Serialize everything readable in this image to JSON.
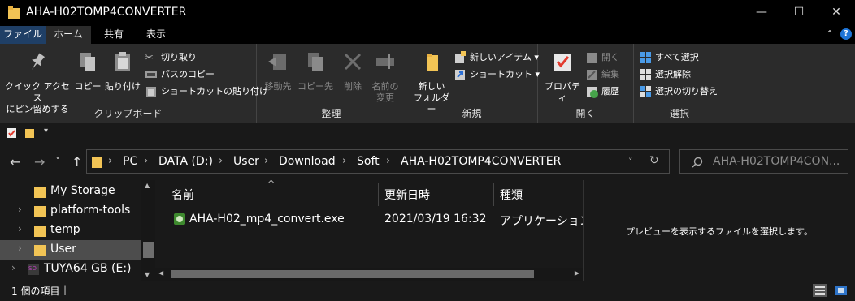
{
  "window": {
    "title": "AHA-H02TOMP4CONVERTER",
    "minimize": "—",
    "maximize": "☐",
    "close": "✕"
  },
  "ribbon_tabs": {
    "file": "ファイル",
    "home": "ホーム",
    "share": "共有",
    "view": "表示",
    "collapse": "⌃",
    "help": "?"
  },
  "clipboard": {
    "pin_line1": "クイック アクセス",
    "pin_line2": "にピン留めする",
    "copy": "コピー",
    "paste": "貼り付け",
    "cut": "切り取り",
    "copy_path": "パスのコピー",
    "paste_shortcut": "ショートカットの貼り付け",
    "label": "クリップボード"
  },
  "organize": {
    "move_to": "移動先",
    "copy_to": "コピー先",
    "delete": "削除",
    "rename_line1": "名前の",
    "rename_line2": "変更",
    "label": "整理"
  },
  "new": {
    "new_folder_line1": "新しい",
    "new_folder_line2": "フォルダー",
    "new_item": "新しいアイテム",
    "shortcut": "ショートカット",
    "label": "新規"
  },
  "open": {
    "properties": "プロパティ",
    "open": "開く",
    "edit": "編集",
    "history": "履歴",
    "label": "開く"
  },
  "select": {
    "select_all": "すべて選択",
    "select_none": "選択解除",
    "invert": "選択の切り替え",
    "label": "選択"
  },
  "navigation": {
    "back": "←",
    "forward": "→",
    "recent": "˅",
    "up": "↑",
    "refresh": "↻",
    "dropdown": "˅"
  },
  "breadcrumb": [
    "PC",
    "DATA (D:)",
    "User",
    "Download",
    "Soft",
    "AHA-H02TOMP4CONVERTER"
  ],
  "search": {
    "placeholder": "AHA-H02TOMP4CON..."
  },
  "nav_pane": {
    "items": [
      {
        "label": "My Storage",
        "chevron": ""
      },
      {
        "label": "platform-tools",
        "chevron": "›"
      },
      {
        "label": "temp",
        "chevron": "›"
      },
      {
        "label": "User",
        "chevron": "›"
      },
      {
        "label": "TUYA64 GB (E:)",
        "chevron": "›"
      }
    ]
  },
  "file_list": {
    "headers": {
      "name": "名前",
      "date": "更新日時",
      "type": "種類"
    },
    "sort_arrow": "^",
    "rows": [
      {
        "name": "AHA-H02_mp4_convert.exe",
        "date": "2021/03/19 16:32",
        "type": "アプリケーション"
      }
    ]
  },
  "preview": {
    "message": "プレビューを表示するファイルを選択します。"
  },
  "status": {
    "item_count": "1 個の項目"
  },
  "colors": {
    "background": "#191919",
    "ribbon": "#2b2b2b",
    "titlebar": "#000000",
    "file_tab": "#1f3f66",
    "folder_yellow": "#f2c455",
    "selection": "#4d4d4d"
  }
}
